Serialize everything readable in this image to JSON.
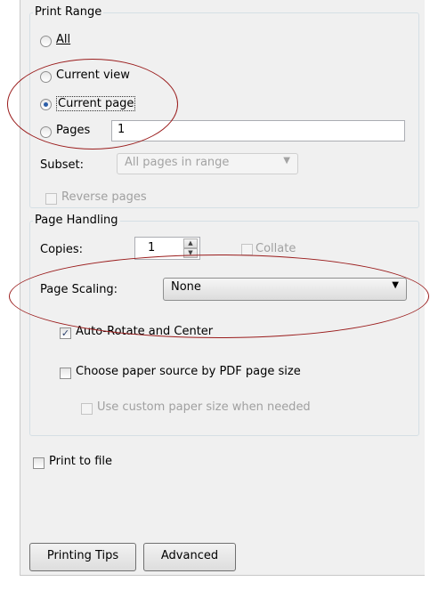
{
  "print_range": {
    "legend": "Print Range",
    "options": [
      {
        "label": "All",
        "selected": false
      },
      {
        "label": "Current view",
        "selected": false
      },
      {
        "label": "Current page",
        "selected": true
      },
      {
        "label": "Pages",
        "selected": false
      }
    ],
    "pages_value": "1",
    "subset_label": "Subset:",
    "subset_value": "All pages in range",
    "reverse_pages_label": "Reverse pages"
  },
  "page_handling": {
    "legend": "Page Handling",
    "copies_label": "Copies:",
    "copies_value": "1",
    "collate_label": "Collate",
    "page_scaling_label": "Page Scaling:",
    "page_scaling_value": "None",
    "auto_rotate_label": "Auto-Rotate and Center",
    "auto_rotate_checked": true,
    "choose_paper_label": "Choose paper source by PDF page size",
    "custom_paper_label": "Use custom paper size when needed"
  },
  "print_to_file_label": "Print to file",
  "buttons": {
    "printing_tips": "Printing Tips",
    "advanced": "Advanced"
  },
  "annotation_color": "#9a1c1c"
}
